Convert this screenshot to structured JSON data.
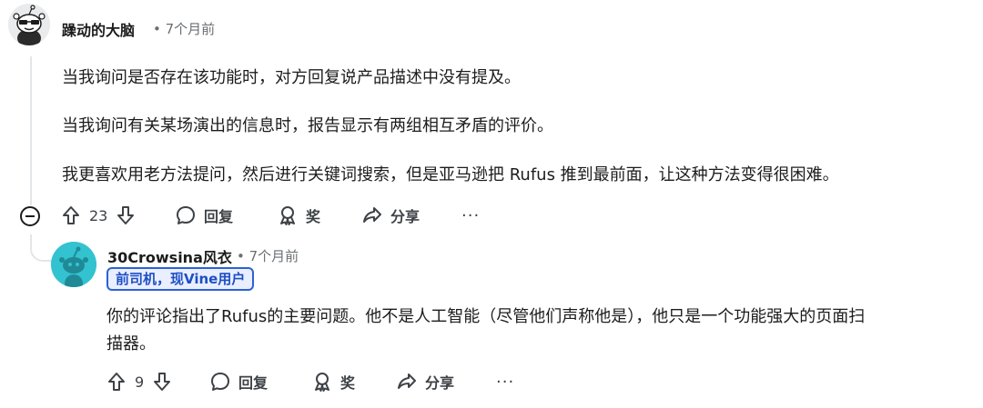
{
  "comment1": {
    "username": "躁动的大脑",
    "time": "• 7个月前",
    "paragraphs": [
      "当我询问是否存在该功能时，对方回复说产品描述中没有提及。",
      "当我询问有关某场演出的信息时，报告显示有两组相互矛盾的评价。",
      "我更喜欢用老方法提问，然后进行关键词搜索，但是亚马逊把 Rufus 推到最前面，让这种方法变得很困难。"
    ],
    "upvotes": "23",
    "reply_label": "回复",
    "award_label": "奖",
    "share_label": "分享",
    "more_label": "···"
  },
  "comment2": {
    "username": "30Crowsina风衣",
    "time": "• 7个月前",
    "badge": "前司机，现Vine用户",
    "line1": "你的评论指出了Rufus的主要问题。他不是人工智能（尽管他们声称他是），他只是一个功能强大的页面扫",
    "line2": "描器。",
    "upvotes": "9",
    "reply_label": "回复",
    "award_label": "奖",
    "share_label": "分享",
    "more_label": "···"
  },
  "colors": {
    "badge_border": "#2c61d6",
    "badge_text": "#1d4fc4",
    "avatar2_bg": "#33c3d0",
    "thread_line": "#e3e6e8"
  },
  "icons": [
    "upvote-icon",
    "downvote-icon",
    "comment-icon",
    "award-icon",
    "share-icon",
    "collapse-icon",
    "more-icon"
  ]
}
